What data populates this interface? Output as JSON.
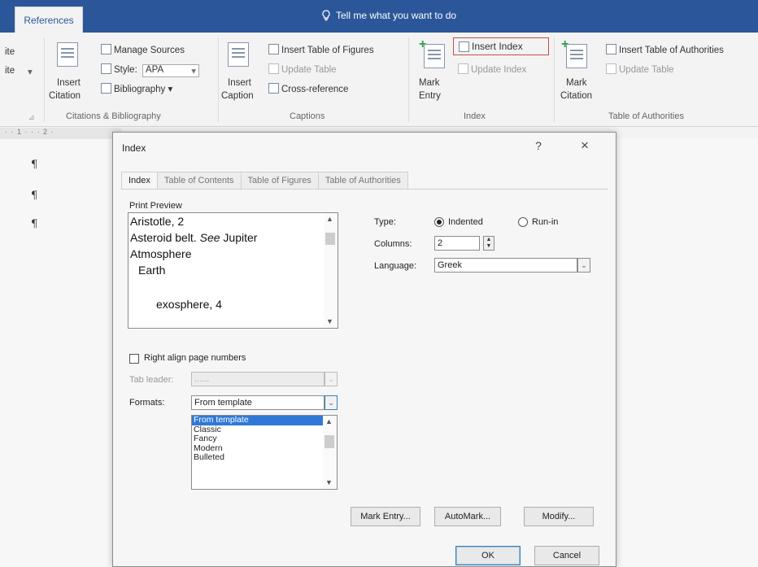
{
  "titlebar": {
    "active_tab": "References",
    "tellme": "Tell me what you want to do"
  },
  "ribbon": {
    "left_cut": {
      "line1": "ite",
      "line2": "ite"
    },
    "citations": {
      "insert_citation_1": "Insert",
      "insert_citation_2": "Citation",
      "manage_sources": "Manage Sources",
      "style_label": "Style:",
      "style_value": "APA",
      "bibliography": "Bibliography",
      "group_label": "Citations & Bibliography"
    },
    "captions": {
      "insert_caption_1": "Insert",
      "insert_caption_2": "Caption",
      "insert_table_of_figures": "Insert Table of Figures",
      "update_table": "Update Table",
      "cross_reference": "Cross-reference",
      "group_label": "Captions"
    },
    "index": {
      "mark_entry_1": "Mark",
      "mark_entry_2": "Entry",
      "insert_index": "Insert Index",
      "update_index": "Update Index",
      "group_label": "Index"
    },
    "authorities": {
      "mark_citation_1": "Mark",
      "mark_citation_2": "Citation",
      "insert_toa": "Insert Table of Authorities",
      "update_table": "Update Table",
      "group_label": "Table of Authorities"
    }
  },
  "ruler": "· · 1 · · · 2 ·",
  "document": {
    "pilcrow": "¶"
  },
  "dialog": {
    "title": "Index",
    "help": "?",
    "close": "×",
    "tabs": [
      "Index",
      "Table of Contents",
      "Table of Figures",
      "Table of Authorities"
    ],
    "print_preview_label": "Print Preview",
    "preview_lines": {
      "l1": "Aristotle, 2",
      "l2a": "Asteroid belt. ",
      "l2b": "See",
      "l2c": " Jupiter",
      "l3": "Atmosphere",
      "l4": "Earth",
      "l5": "exosphere, 4"
    },
    "type_label": "Type:",
    "type_options": {
      "indented": "Indented",
      "runin": "Run-in"
    },
    "type_selected": "Indented",
    "columns_label": "Columns:",
    "columns_value": "2",
    "language_label": "Language:",
    "language_value": "Greek",
    "right_align_label": "Right align page numbers",
    "tab_leader_label": "Tab leader:",
    "tab_leader_value": "......",
    "formats_label": "Formats:",
    "formats_value": "From template",
    "formats_options": [
      "From template",
      "Classic",
      "Fancy",
      "Modern",
      "Bulleted"
    ],
    "buttons": {
      "mark_entry": "Mark Entry...",
      "automark": "AutoMark...",
      "modify": "Modify...",
      "ok": "OK",
      "cancel": "Cancel"
    }
  }
}
